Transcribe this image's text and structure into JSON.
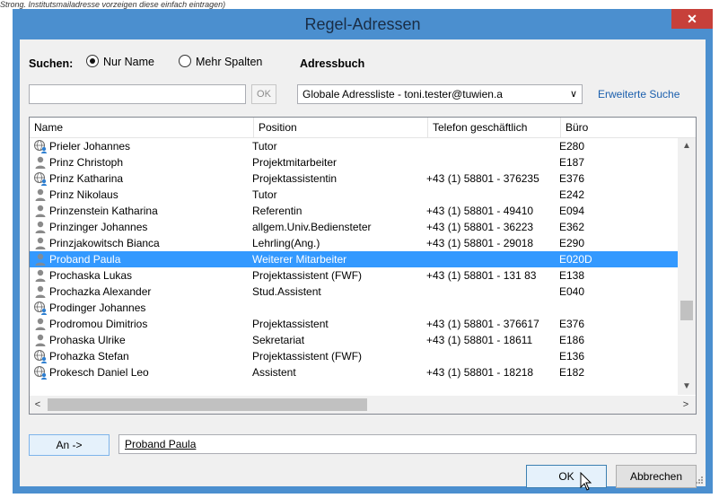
{
  "top_note": "Strong. Institutsmailadresse vorzeigen diese einfach eintragen)",
  "window": {
    "title": "Regel-Adressen",
    "close_glyph": "✕"
  },
  "search": {
    "label": "Suchen:",
    "option_name": "Nur Name",
    "option_columns": "Mehr Spalten",
    "selected": "Nur Name",
    "input_value": "",
    "ok_label": "OK"
  },
  "addressbook": {
    "label": "Adressbuch",
    "selected": "Globale Adressliste - toni.tester@tuwien.a",
    "advanced_search": "Erweiterte Suche"
  },
  "columns": [
    "Name",
    "Position",
    "Telefon geschäftlich",
    "Büro"
  ],
  "rows": [
    {
      "icon": "globe-user-icon",
      "name": "Prieler Johannes",
      "position": "Tutor",
      "phone": "",
      "office": "E280"
    },
    {
      "icon": "user-icon",
      "name": "Prinz Christoph",
      "position": "Projektmitarbeiter",
      "phone": "",
      "office": "E187"
    },
    {
      "icon": "globe-user-icon",
      "name": "Prinz Katharina",
      "position": "Projektassistentin",
      "phone": "+43 (1) 58801 - 376235",
      "office": "E376"
    },
    {
      "icon": "user-icon",
      "name": "Prinz Nikolaus",
      "position": "Tutor",
      "phone": "",
      "office": "E242"
    },
    {
      "icon": "user-icon",
      "name": "Prinzenstein Katharina",
      "position": "Referentin",
      "phone": "+43 (1) 58801 - 49410",
      "office": "E094"
    },
    {
      "icon": "user-icon",
      "name": "Prinzinger Johannes",
      "position": "allgem.Univ.Bediensteter",
      "phone": "+43 (1) 58801 - 36223",
      "office": "E362"
    },
    {
      "icon": "user-icon",
      "name": "Prinzjakowitsch Bianca",
      "position": "Lehrling(Ang.)",
      "phone": "+43 (1) 58801 - 29018",
      "office": "E290"
    },
    {
      "icon": "user-icon",
      "name": "Proband Paula",
      "position": "Weiterer Mitarbeiter",
      "phone": "",
      "office": "E020D",
      "selected": true
    },
    {
      "icon": "user-icon",
      "name": "Prochaska Lukas",
      "position": "Projektassistent (FWF)",
      "phone": "+43 (1) 58801 - 131 83",
      "office": "E138"
    },
    {
      "icon": "user-icon",
      "name": "Prochazka Alexander",
      "position": "Stud.Assistent",
      "phone": "",
      "office": "E040"
    },
    {
      "icon": "globe-user-icon",
      "name": "Prodinger Johannes",
      "position": "",
      "phone": "",
      "office": ""
    },
    {
      "icon": "user-icon",
      "name": "Prodromou Dimitrios",
      "position": "Projektassistent",
      "phone": "+43 (1) 58801 - 376617",
      "office": "E376"
    },
    {
      "icon": "user-icon",
      "name": "Prohaska Ulrike",
      "position": "Sekretariat",
      "phone": "+43 (1) 58801 - 18611",
      "office": "E186"
    },
    {
      "icon": "globe-user-icon",
      "name": "Prohazka Stefan",
      "position": "Projektassistent (FWF)",
      "phone": "",
      "office": "E136"
    },
    {
      "icon": "globe-user-icon",
      "name": "Prokesch Daniel Leo",
      "position": "Assistent",
      "phone": "+43 (1) 58801 - 18218",
      "office": "E182"
    }
  ],
  "recipient": {
    "button": "An ->",
    "value": "Proband Paula"
  },
  "buttons": {
    "ok": "OK",
    "cancel": "Abbrechen"
  },
  "colors": {
    "frame": "#4b8fcf",
    "selection": "#3399ff",
    "close": "#c7403a",
    "link": "#1b5fad"
  }
}
